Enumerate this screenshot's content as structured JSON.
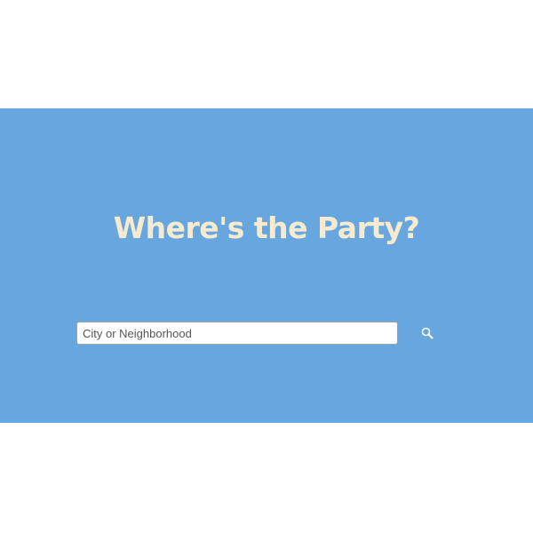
{
  "hero": {
    "title": "Where's the Party?",
    "background_color": "#67a6df",
    "title_color": "#f7ebcf"
  },
  "search": {
    "placeholder": "City or Neighborhood",
    "value": "",
    "button_icon": "search-icon"
  }
}
